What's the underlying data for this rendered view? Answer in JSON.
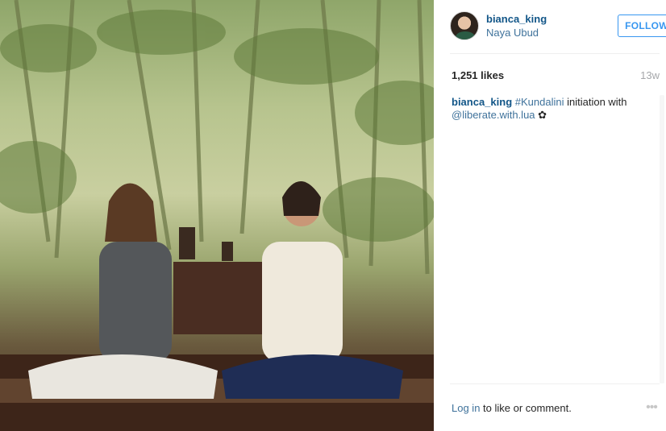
{
  "post": {
    "username": "bianca_king",
    "location": "Naya Ubud",
    "follow_label": "FOLLOW",
    "likes": "1,251 likes",
    "time_ago": "13w",
    "caption": {
      "user": "bianca_king",
      "hashtag": "#Kundalini",
      "text": " initiation with ",
      "mention": "@liberate.with.lua",
      "emoji": " ✿"
    }
  },
  "footer": {
    "login_link": "Log in",
    "login_text": " to like or comment.",
    "more_glyph": "•••"
  },
  "icons": {
    "more": "more-options-icon",
    "avatar": "profile-avatar"
  },
  "colors": {
    "link": "#125688",
    "secondary_link": "#3f729b",
    "follow": "#3897f0"
  }
}
